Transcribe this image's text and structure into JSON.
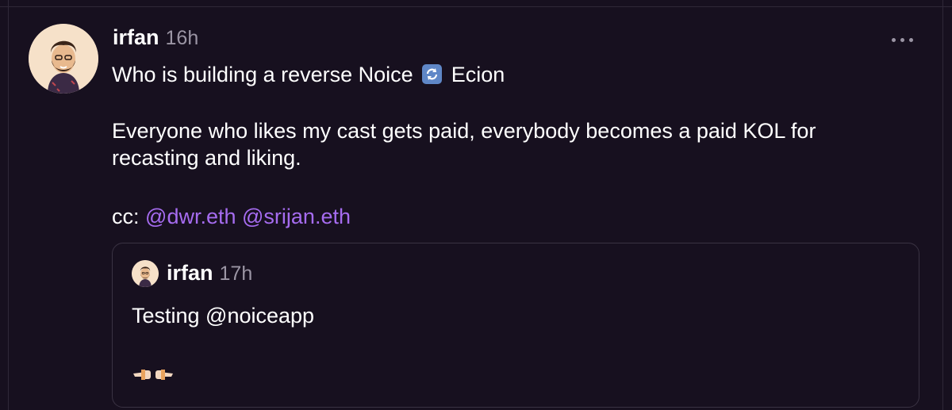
{
  "cast": {
    "author": "irfan",
    "time": "16h",
    "line1_before": "Who is building a reverse Noice",
    "line1_icon": "counterclockwise-arrows-emoji",
    "line1_after": "Ecion",
    "line2": "Everyone who likes my cast gets paid, everybody becomes a paid KOL for",
    "line3": "recasting and liking.",
    "cc_prefix": "cc:",
    "mentions": [
      "@dwr.eth",
      "@srijan.eth"
    ]
  },
  "quote": {
    "author": "irfan",
    "time": "17h",
    "text": "Testing @noiceapp",
    "emoji": "pointing-hands-emoji"
  },
  "colors": {
    "background": "#17101f",
    "mention": "#a66cf0",
    "muted": "#9b95a4",
    "border": "#3a3343"
  }
}
